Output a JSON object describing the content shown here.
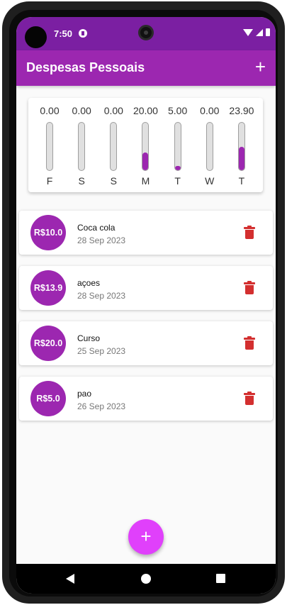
{
  "status_bar": {
    "time": "7:50"
  },
  "app_bar": {
    "title": "Despesas Pessoais",
    "add_icon": "plus-icon",
    "add_label": "+"
  },
  "chart_data": {
    "type": "bar",
    "categories": [
      "F",
      "S",
      "S",
      "M",
      "T",
      "W",
      "T"
    ],
    "values": [
      0.0,
      0.0,
      0.0,
      20.0,
      5.0,
      0.0,
      23.9
    ],
    "value_labels": [
      "0.00",
      "0.00",
      "0.00",
      "20.00",
      "5.00",
      "0.00",
      "23.90"
    ],
    "fill_fractions": [
      0,
      0,
      0,
      0.37,
      0.09,
      0,
      0.49
    ],
    "bar_color": "#9c27b0"
  },
  "transactions": [
    {
      "amount": "R$10.0",
      "title": "Coca cola",
      "date": "28 Sep 2023"
    },
    {
      "amount": "R$13.9",
      "title": "açoes",
      "date": "28 Sep 2023"
    },
    {
      "amount": "R$20.0",
      "title": "Curso",
      "date": "25 Sep 2023"
    },
    {
      "amount": "R$5.0",
      "title": "pao",
      "date": "26 Sep 2023"
    }
  ],
  "fab": {
    "label": "+",
    "icon": "plus-icon"
  },
  "colors": {
    "primary": "#9c27b0",
    "primary_dark": "#7b1fa2",
    "accent": "#e040fb",
    "delete": "#d32f2f"
  }
}
